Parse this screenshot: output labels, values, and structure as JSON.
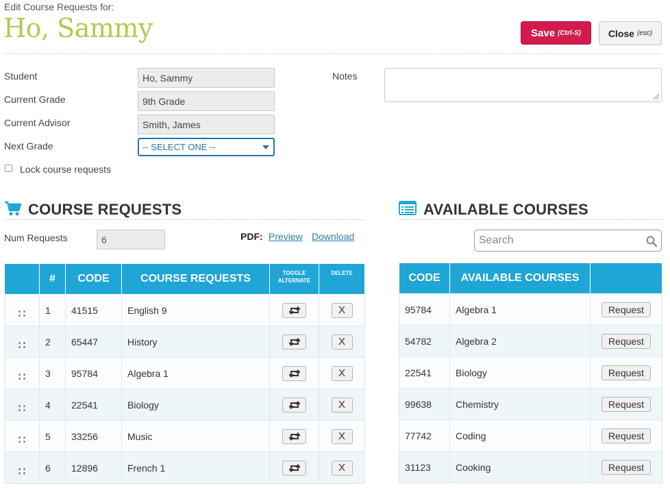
{
  "header": {
    "subtitle": "Edit Course Requests for:",
    "student_name": "Ho, Sammy",
    "save_label": "Save",
    "save_hint": "(Ctrl-S)",
    "close_label": "Close",
    "close_hint": "(esc)"
  },
  "form": {
    "student_label": "Student",
    "student_value": "Ho, Sammy",
    "grade_label": "Current Grade",
    "grade_value": "9th Grade",
    "advisor_label": "Current Advisor",
    "advisor_value": "Smith, James",
    "next_grade_label": "Next Grade",
    "next_grade_value": "-- SELECT ONE --",
    "lock_label": "Lock course requests",
    "lock_checked": false,
    "notes_label": "Notes",
    "notes_value": ""
  },
  "course_requests": {
    "title": "COURSE REQUESTS",
    "num_label": "Num Requests",
    "num_value": "6",
    "pdf_label": "PDF:",
    "preview_label": "Preview",
    "download_label": "Download",
    "columns": {
      "num": "#",
      "code": "CODE",
      "name": "COURSE REQUESTS",
      "toggle": "TOGGLE ALTERNATE",
      "delete": "DELETE"
    },
    "delete_label": "X",
    "rows": [
      {
        "num": "1",
        "code": "41515",
        "name": "English 9"
      },
      {
        "num": "2",
        "code": "65447",
        "name": "History"
      },
      {
        "num": "3",
        "code": "95784",
        "name": "Algebra 1"
      },
      {
        "num": "4",
        "code": "22541",
        "name": "Biology"
      },
      {
        "num": "5",
        "code": "33256",
        "name": "Music"
      },
      {
        "num": "6",
        "code": "12896",
        "name": "French 1"
      }
    ]
  },
  "available_courses": {
    "title": "AVAILABLE COURSES",
    "search_placeholder": "Search",
    "columns": {
      "code": "CODE",
      "name": "AVAILABLE COURSES",
      "action": ""
    },
    "request_label": "Request",
    "rows": [
      {
        "code": "95784",
        "name": "Algebra 1"
      },
      {
        "code": "54782",
        "name": "Algebra 2"
      },
      {
        "code": "22541",
        "name": "Biology"
      },
      {
        "code": "99638",
        "name": "Chemistry"
      },
      {
        "code": "77742",
        "name": "Coding"
      },
      {
        "code": "31123",
        "name": "Cooking"
      }
    ]
  },
  "icons": {
    "cart": "shopping-cart-icon",
    "list": "list-icon",
    "search": "search-icon",
    "toggle": "retweet-icon",
    "drag": "drag-handle-icon"
  },
  "colors": {
    "accent": "#1fa5d6",
    "save": "#d31c4e",
    "name": "#b5c84a",
    "link": "#2a7fa8"
  }
}
